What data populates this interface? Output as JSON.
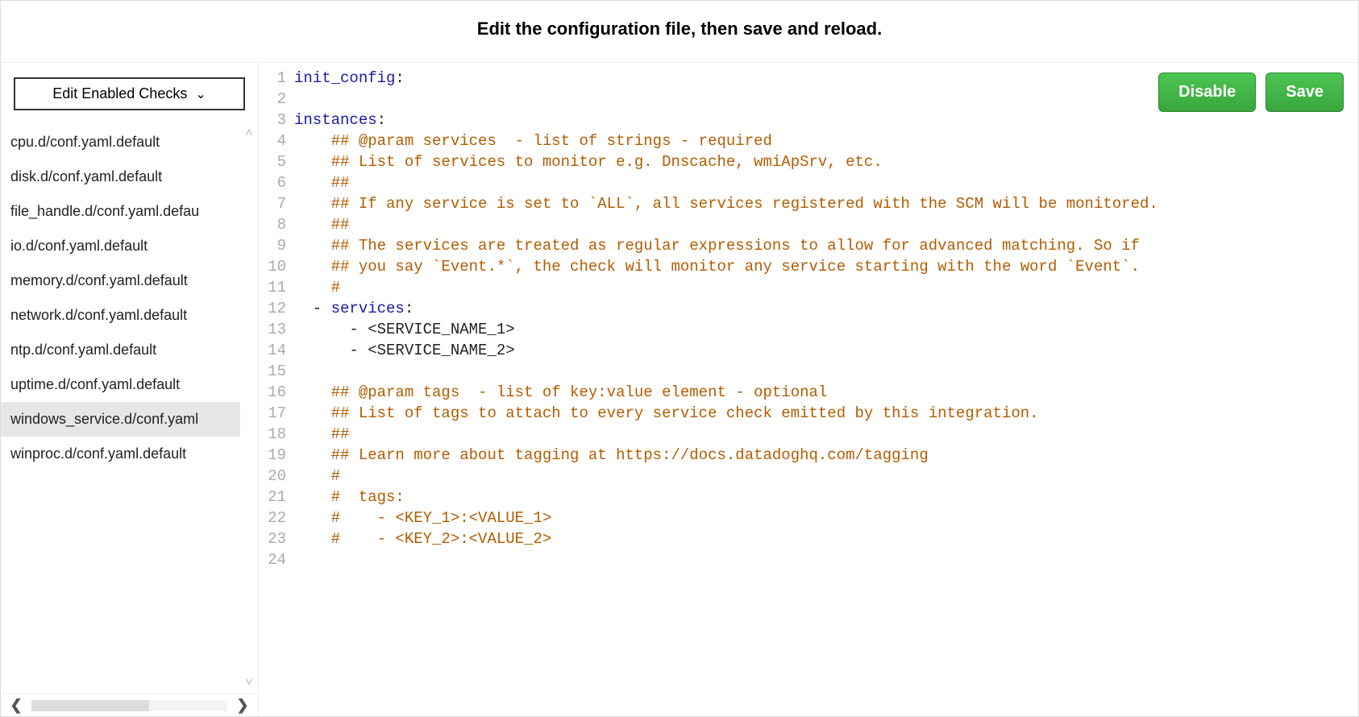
{
  "header": {
    "title": "Edit the configuration file, then save and reload."
  },
  "sidebar": {
    "dropdown_label": "Edit Enabled Checks",
    "files": [
      {
        "name": "cpu.d/conf.yaml.default",
        "selected": false
      },
      {
        "name": "disk.d/conf.yaml.default",
        "selected": false
      },
      {
        "name": "file_handle.d/conf.yaml.defau",
        "selected": false
      },
      {
        "name": "io.d/conf.yaml.default",
        "selected": false
      },
      {
        "name": "memory.d/conf.yaml.default",
        "selected": false
      },
      {
        "name": "network.d/conf.yaml.default",
        "selected": false
      },
      {
        "name": "ntp.d/conf.yaml.default",
        "selected": false
      },
      {
        "name": "uptime.d/conf.yaml.default",
        "selected": false
      },
      {
        "name": "windows_service.d/conf.yaml",
        "selected": true
      },
      {
        "name": "winproc.d/conf.yaml.default",
        "selected": false
      }
    ]
  },
  "actions": {
    "disable_label": "Disable",
    "save_label": "Save"
  },
  "editor": {
    "lines": [
      [
        {
          "t": "key",
          "v": "init_config"
        },
        {
          "t": "plain",
          "v": ":"
        }
      ],
      [],
      [
        {
          "t": "key",
          "v": "instances"
        },
        {
          "t": "plain",
          "v": ":"
        }
      ],
      [
        {
          "t": "plain",
          "v": "    "
        },
        {
          "t": "comment",
          "v": "## @param services  - list of strings - required"
        }
      ],
      [
        {
          "t": "plain",
          "v": "    "
        },
        {
          "t": "comment",
          "v": "## List of services to monitor e.g. Dnscache, wmiApSrv, etc."
        }
      ],
      [
        {
          "t": "plain",
          "v": "    "
        },
        {
          "t": "comment",
          "v": "##"
        }
      ],
      [
        {
          "t": "plain",
          "v": "    "
        },
        {
          "t": "comment",
          "v": "## If any service is set to `ALL`, all services registered with the SCM will be monitored."
        }
      ],
      [
        {
          "t": "plain",
          "v": "    "
        },
        {
          "t": "comment",
          "v": "##"
        }
      ],
      [
        {
          "t": "plain",
          "v": "    "
        },
        {
          "t": "comment",
          "v": "## The services are treated as regular expressions to allow for advanced matching. So if"
        }
      ],
      [
        {
          "t": "plain",
          "v": "    "
        },
        {
          "t": "comment",
          "v": "## you say `Event.*`, the check will monitor any service starting with the word `Event`."
        }
      ],
      [
        {
          "t": "plain",
          "v": "    "
        },
        {
          "t": "comment",
          "v": "#"
        }
      ],
      [
        {
          "t": "plain",
          "v": "  - "
        },
        {
          "t": "key",
          "v": "services"
        },
        {
          "t": "plain",
          "v": ":"
        }
      ],
      [
        {
          "t": "plain",
          "v": "      - <SERVICE_NAME_1>"
        }
      ],
      [
        {
          "t": "plain",
          "v": "      - <SERVICE_NAME_2>"
        }
      ],
      [],
      [
        {
          "t": "plain",
          "v": "    "
        },
        {
          "t": "comment",
          "v": "## @param tags  - list of key:value element - optional"
        }
      ],
      [
        {
          "t": "plain",
          "v": "    "
        },
        {
          "t": "comment",
          "v": "## List of tags to attach to every service check emitted by this integration."
        }
      ],
      [
        {
          "t": "plain",
          "v": "    "
        },
        {
          "t": "comment",
          "v": "##"
        }
      ],
      [
        {
          "t": "plain",
          "v": "    "
        },
        {
          "t": "comment",
          "v": "## Learn more about tagging at https://docs.datadoghq.com/tagging"
        }
      ],
      [
        {
          "t": "plain",
          "v": "    "
        },
        {
          "t": "comment",
          "v": "#"
        }
      ],
      [
        {
          "t": "plain",
          "v": "    "
        },
        {
          "t": "comment",
          "v": "#  tags:"
        }
      ],
      [
        {
          "t": "plain",
          "v": "    "
        },
        {
          "t": "comment",
          "v": "#    - <KEY_1>:<VALUE_1>"
        }
      ],
      [
        {
          "t": "plain",
          "v": "    "
        },
        {
          "t": "comment",
          "v": "#    - <KEY_2>:<VALUE_2>"
        }
      ],
      []
    ]
  }
}
